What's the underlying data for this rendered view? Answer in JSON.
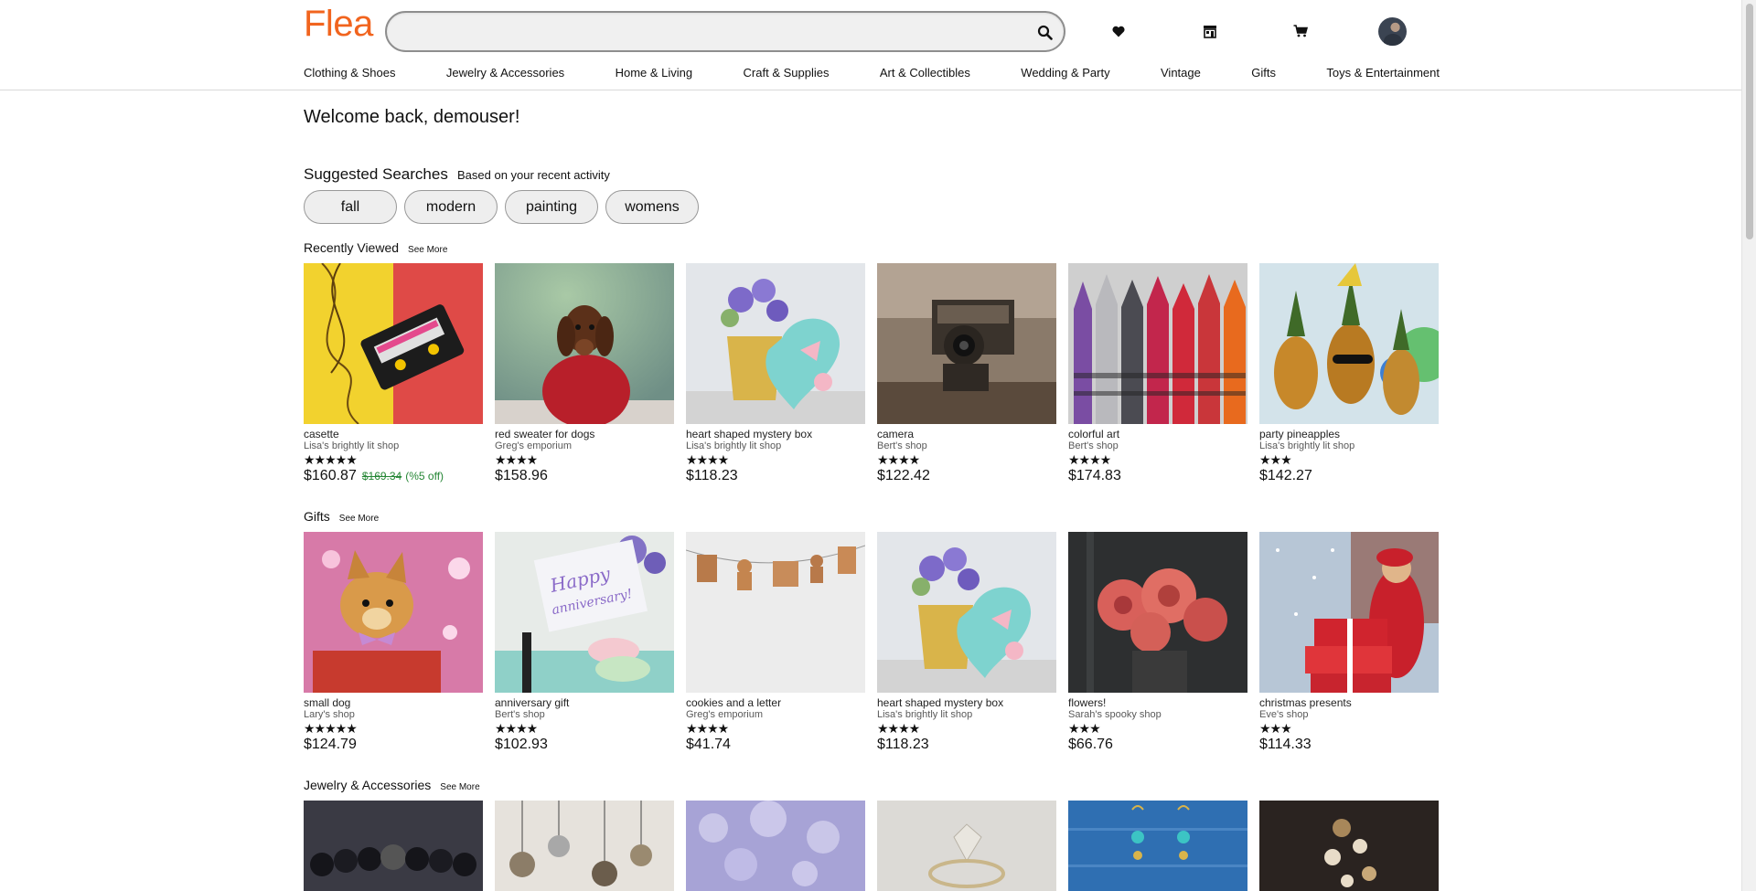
{
  "header": {
    "logo": "Flea",
    "search": {
      "value": "",
      "placeholder": ""
    },
    "icons": [
      "favorites-icon",
      "shop-icon",
      "cart-icon"
    ]
  },
  "nav": [
    "Clothing & Shoes",
    "Jewelry & Accessories",
    "Home & Living",
    "Craft & Supplies",
    "Art & Collectibles",
    "Wedding & Party",
    "Vintage",
    "Gifts",
    "Toys & Entertainment"
  ],
  "welcome": "Welcome back, demouser!",
  "suggested": {
    "title": "Suggested Searches",
    "subtitle": "Based on your recent activity",
    "chips": [
      "fall",
      "modern",
      "painting",
      "womens"
    ]
  },
  "sections": {
    "recent": {
      "title": "Recently Viewed",
      "see_more": "See More",
      "items": [
        {
          "title": "casette",
          "shop": "Lisa's brightly lit shop",
          "stars": "★★★★★",
          "price": "$160.87",
          "old_price": "$169.34",
          "discount": "(%5 off)"
        },
        {
          "title": "red sweater for dogs",
          "shop": "Greg's emporium",
          "stars": "★★★★",
          "price": "$158.96"
        },
        {
          "title": "heart shaped mystery box",
          "shop": "Lisa's brightly lit shop",
          "stars": "★★★★",
          "price": "$118.23"
        },
        {
          "title": "camera",
          "shop": "Bert's shop",
          "stars": "★★★★",
          "price": "$122.42"
        },
        {
          "title": "colorful art",
          "shop": "Bert's shop",
          "stars": "★★★★",
          "price": "$174.83"
        },
        {
          "title": "party pineapples",
          "shop": "Lisa's brightly lit shop",
          "stars": "★★★",
          "price": "$142.27"
        }
      ]
    },
    "gifts": {
      "title": "Gifts",
      "see_more": "See More",
      "items": [
        {
          "title": "small dog",
          "shop": "Lary's shop",
          "stars": "★★★★★",
          "price": "$124.79"
        },
        {
          "title": "anniversary gift",
          "shop": "Bert's shop",
          "stars": "★★★★",
          "price": "$102.93"
        },
        {
          "title": "cookies and a letter",
          "shop": "Greg's emporium",
          "stars": "★★★★",
          "price": "$41.74"
        },
        {
          "title": "heart shaped mystery box",
          "shop": "Lisa's brightly lit shop",
          "stars": "★★★★",
          "price": "$118.23"
        },
        {
          "title": "flowers!",
          "shop": "Sarah's spooky shop",
          "stars": "★★★",
          "price": "$66.76"
        },
        {
          "title": "christmas presents",
          "shop": "Eve's shop",
          "stars": "★★★",
          "price": "$114.33"
        }
      ]
    },
    "jewelry": {
      "title": "Jewelry & Accessories",
      "see_more": "See More"
    }
  },
  "colors": {
    "brand": "#f1641e",
    "discount": "#258635"
  }
}
